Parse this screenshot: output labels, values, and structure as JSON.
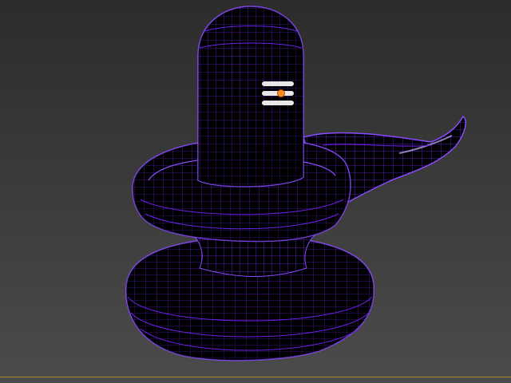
{
  "viewport": {
    "background_top": "#2f2f2f",
    "background_bottom": "#4a4a4a",
    "active_border_color": "#a58a2e"
  },
  "model": {
    "name": "shiva-lingam-wireframe",
    "fill_color": "#000000",
    "wire_color": "#6a22e6",
    "wire_highlight_color": "#9a6cff",
    "tilak_stripe_color": "#e8e8e8",
    "tilak_dot_color": "#ff8c1a"
  }
}
